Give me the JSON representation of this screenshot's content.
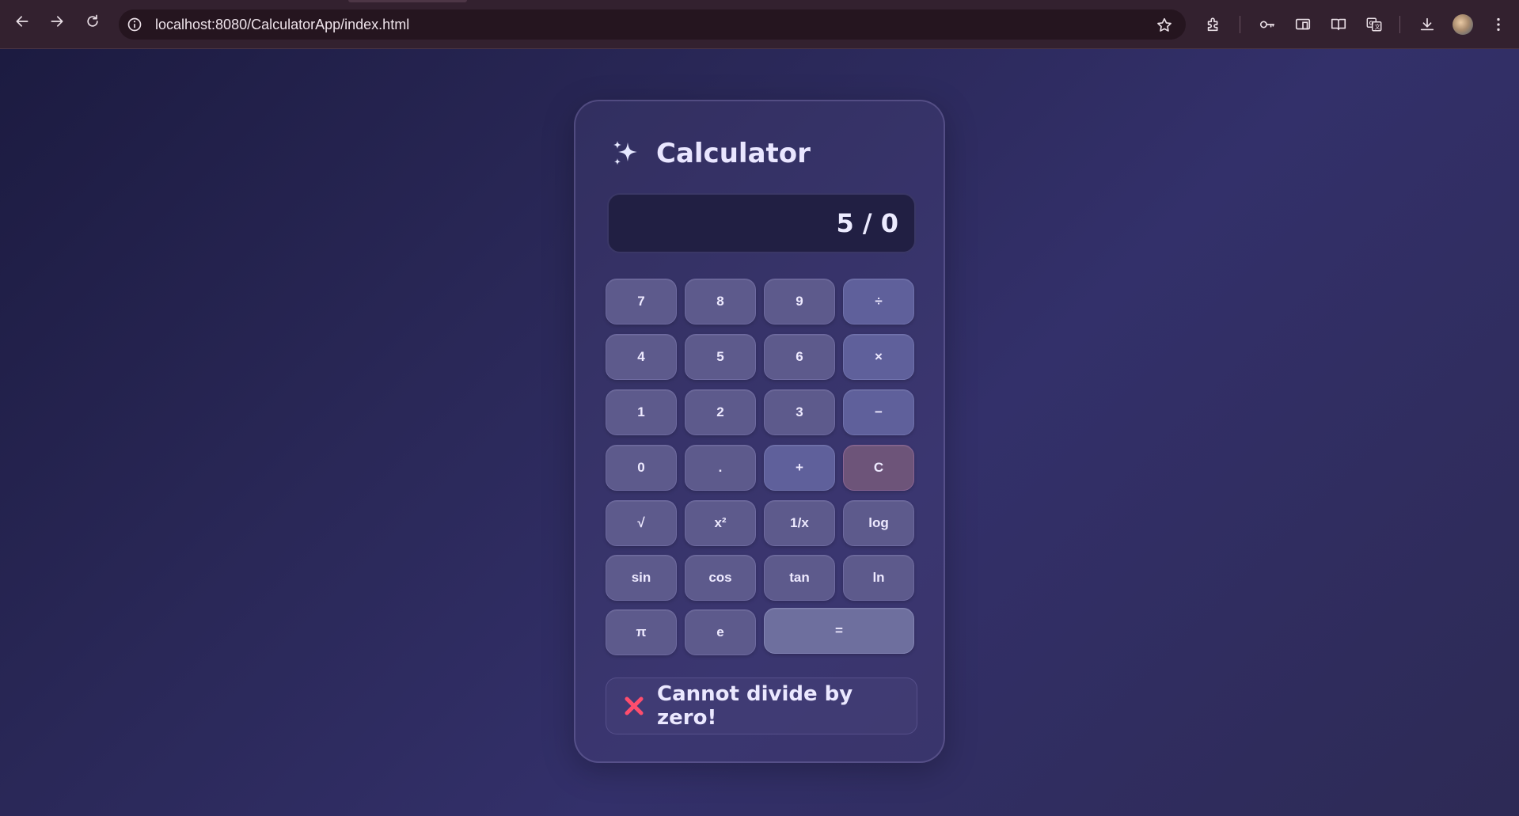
{
  "browser": {
    "url": "localhost:8080/CalculatorApp/index.html"
  },
  "calculator": {
    "title": "Calculator",
    "display_value": "5 / 0",
    "keys": [
      {
        "label": "7",
        "kind": "digit"
      },
      {
        "label": "8",
        "kind": "digit"
      },
      {
        "label": "9",
        "kind": "digit"
      },
      {
        "label": "÷",
        "kind": "op"
      },
      {
        "label": "4",
        "kind": "digit"
      },
      {
        "label": "5",
        "kind": "digit"
      },
      {
        "label": "6",
        "kind": "digit"
      },
      {
        "label": "×",
        "kind": "op"
      },
      {
        "label": "1",
        "kind": "digit"
      },
      {
        "label": "2",
        "kind": "digit"
      },
      {
        "label": "3",
        "kind": "digit"
      },
      {
        "label": "−",
        "kind": "op"
      },
      {
        "label": "0",
        "kind": "digit"
      },
      {
        "label": ".",
        "kind": "digit"
      },
      {
        "label": "+",
        "kind": "op"
      },
      {
        "label": "C",
        "kind": "clear"
      },
      {
        "label": "√",
        "kind": "func"
      },
      {
        "label": "x²",
        "kind": "func"
      },
      {
        "label": "1/x",
        "kind": "func"
      },
      {
        "label": "log",
        "kind": "func"
      },
      {
        "label": "sin",
        "kind": "func"
      },
      {
        "label": "cos",
        "kind": "func"
      },
      {
        "label": "tan",
        "kind": "func"
      },
      {
        "label": "ln",
        "kind": "func"
      },
      {
        "label": "π",
        "kind": "func"
      },
      {
        "label": "e",
        "kind": "func"
      },
      {
        "label": "=",
        "kind": "eq"
      }
    ],
    "error_message": "Cannot divide by zero!"
  },
  "colors": {
    "accent_error": "#ff4d6d",
    "sparkle": "#e6e8ff"
  },
  "icons": [
    "back-icon",
    "forward-icon",
    "reload-icon",
    "info-icon",
    "star-icon",
    "extensions-icon",
    "key-icon",
    "cast-icon",
    "reading-mode-icon",
    "translate-icon",
    "download-icon",
    "avatar",
    "more-icon",
    "sparkle-icon",
    "error-x-icon"
  ]
}
